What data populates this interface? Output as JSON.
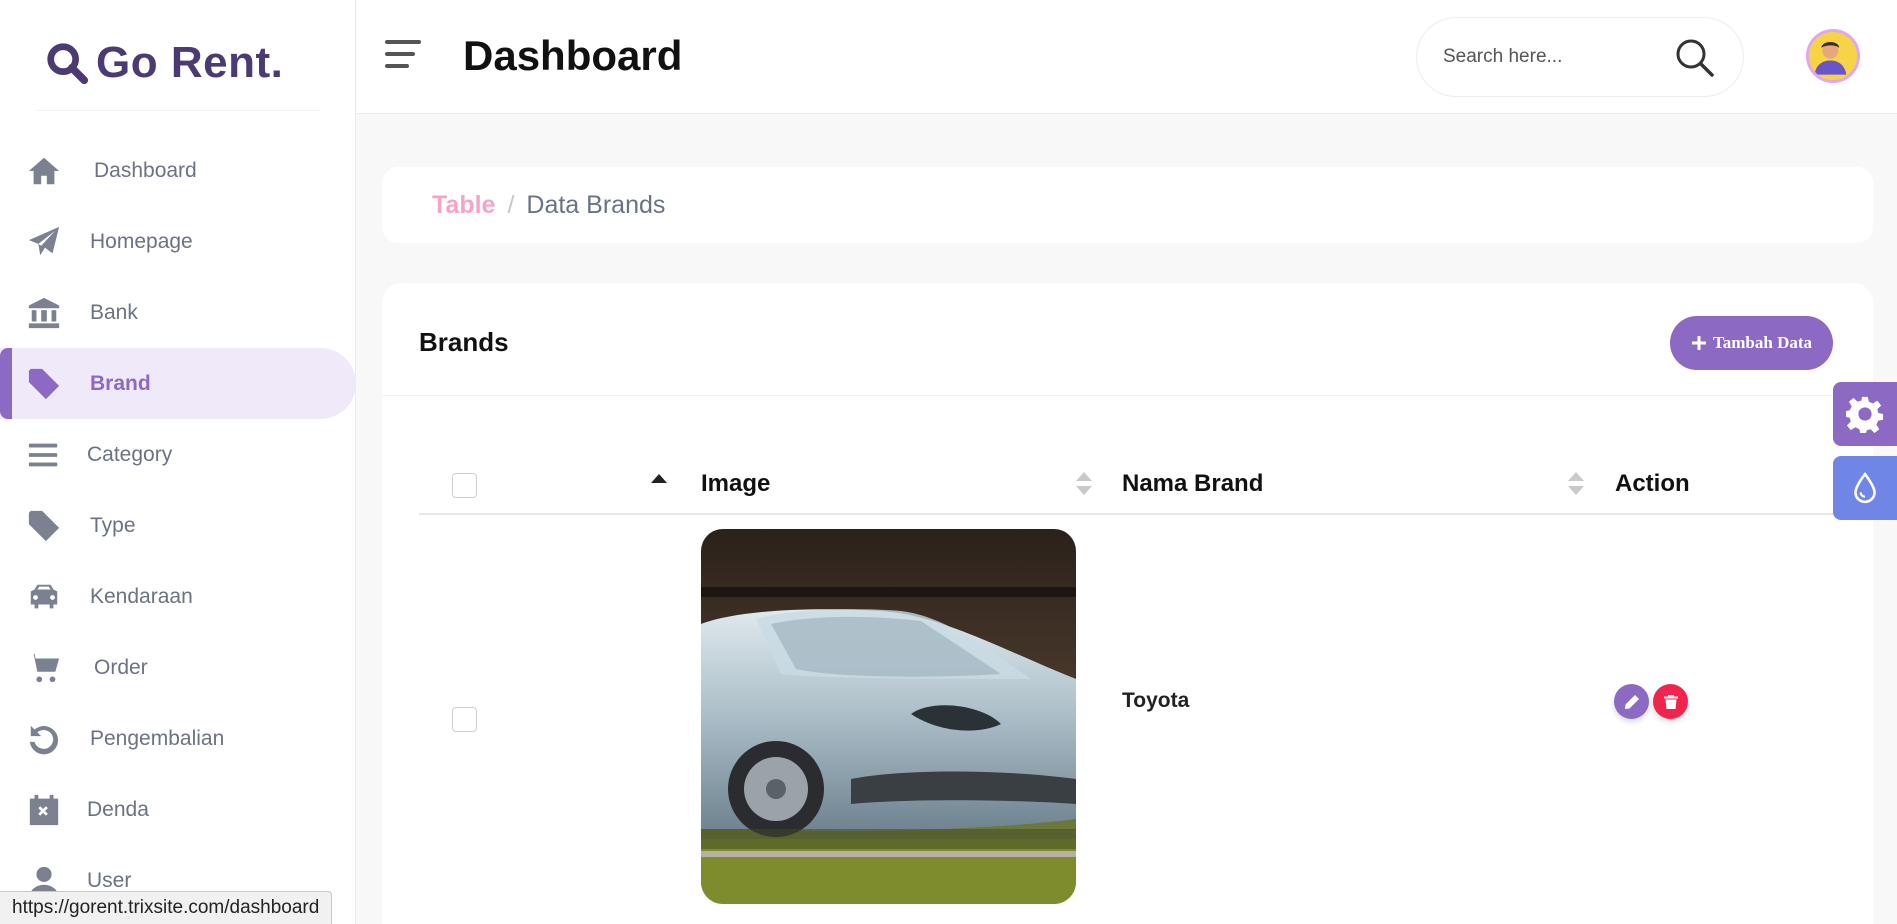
{
  "app": {
    "logo_text": "Go Rent."
  },
  "sidebar": {
    "items": [
      {
        "label": "Dashboard",
        "icon": "home-icon"
      },
      {
        "label": "Homepage",
        "icon": "paper-plane-icon"
      },
      {
        "label": "Bank",
        "icon": "bank-icon"
      },
      {
        "label": "Brand",
        "icon": "tag-icon",
        "active": true
      },
      {
        "label": "Category",
        "icon": "list-icon"
      },
      {
        "label": "Type",
        "icon": "tag-icon"
      },
      {
        "label": "Kendaraan",
        "icon": "car-icon"
      },
      {
        "label": "Order",
        "icon": "cart-icon"
      },
      {
        "label": "Pengembalian",
        "icon": "undo-icon"
      },
      {
        "label": "Denda",
        "icon": "calendar-x-icon"
      },
      {
        "label": "User",
        "icon": "user-icon"
      }
    ]
  },
  "header": {
    "title": "Dashboard",
    "search_placeholder": "Search here..."
  },
  "breadcrumb": {
    "link": "Table",
    "separator": "/",
    "current": "Data Brands"
  },
  "card": {
    "title": "Brands",
    "add_button": "Tambah Data",
    "columns": [
      "Image",
      "Nama Brand",
      "Action"
    ],
    "rows": [
      {
        "nama_brand": "Toyota"
      }
    ]
  },
  "status_url": "https://gorent.trixsite.com/dashboard",
  "colors": {
    "accent": "#8c6ac4",
    "danger": "#f0244d",
    "breadcrumb_link": "#f7a3c8",
    "theme_button": "#6f86e6"
  }
}
